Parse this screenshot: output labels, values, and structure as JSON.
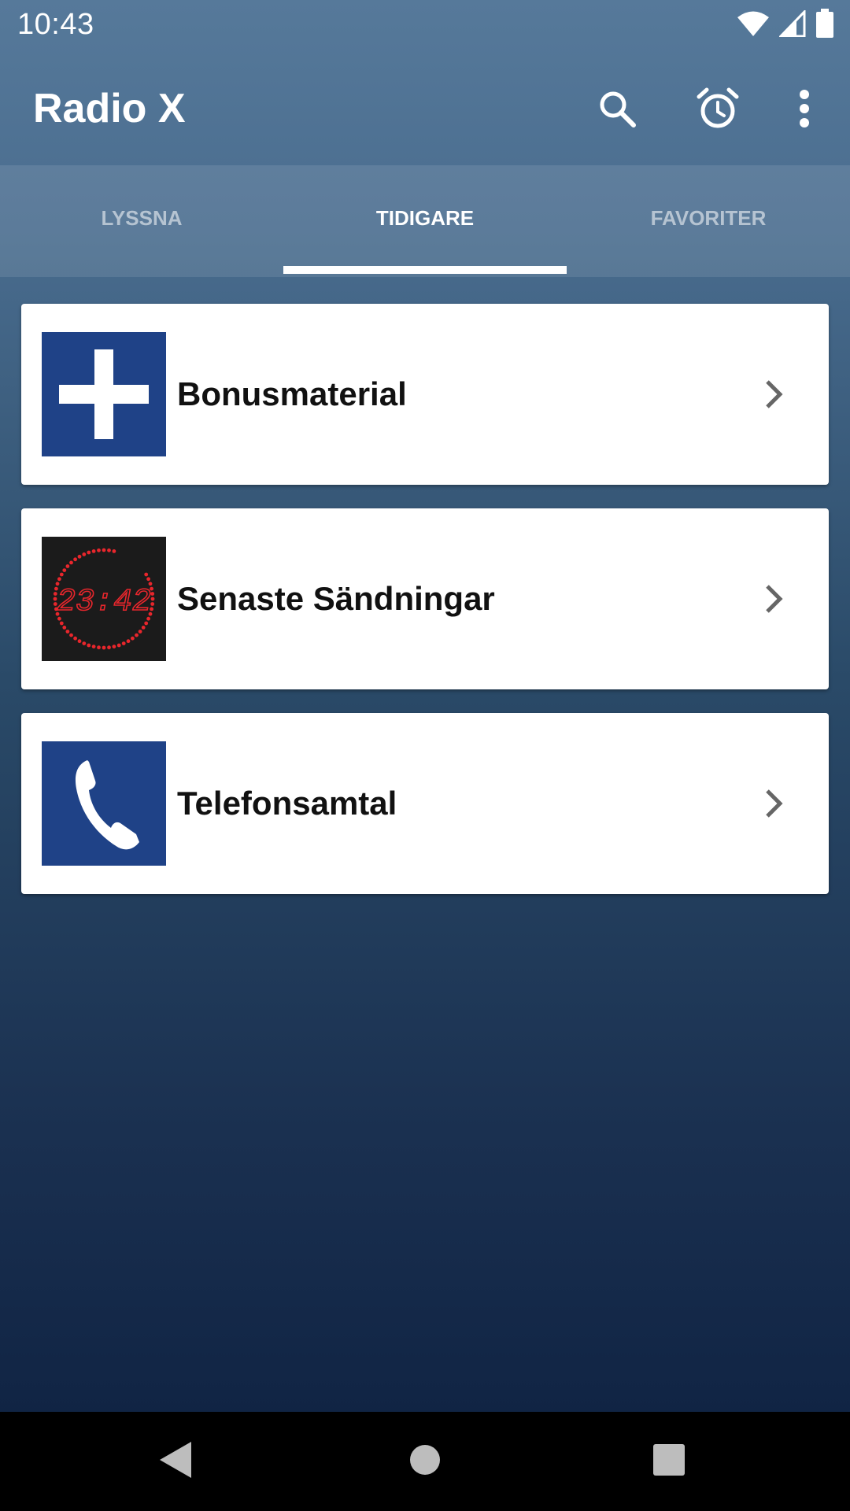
{
  "status_bar": {
    "time": "10:43",
    "icons": [
      "wifi-icon",
      "signal-icon",
      "battery-icon"
    ]
  },
  "app_bar": {
    "title": "Radio X",
    "actions": [
      "search-icon",
      "alarm-icon",
      "more-vert-icon"
    ]
  },
  "tabs": [
    {
      "label": "LYSSNA",
      "active": false
    },
    {
      "label": "TIDIGARE",
      "active": true
    },
    {
      "label": "FAVORITER",
      "active": false
    }
  ],
  "items": [
    {
      "label": "Bonusmaterial",
      "icon": "plus-icon"
    },
    {
      "label": "Senaste Sändningar",
      "icon": "clock-icon",
      "clock_text": "23:42"
    },
    {
      "label": "Telefonsamtal",
      "icon": "phone-icon"
    }
  ],
  "colors": {
    "accent_blue": "#1f4287",
    "indicator": "#ffffff",
    "clock_red": "#e8262c"
  },
  "nav": [
    "back-icon",
    "home-icon",
    "recents-icon"
  ]
}
